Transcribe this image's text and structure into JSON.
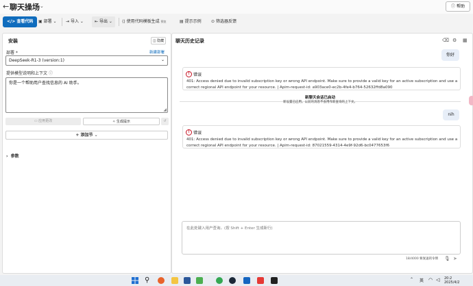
{
  "header": {
    "back_icon": "arrow-left-icon",
    "title": "聊天操场",
    "help_label": "帮助"
  },
  "toolbar": {
    "view_code": "查看代码",
    "deploy": "部署",
    "import": "导入",
    "export": "导出",
    "gen_template": "使用代码模板生成",
    "gen_tag": "预览",
    "prompt_samples": "提示示例",
    "filter_feedback": "筛选器反馈"
  },
  "left": {
    "title": "安装",
    "hide_label": "隐藏",
    "deploy_label": "部署 *",
    "new_deploy_link": "新建部署",
    "deploy_value": "DeepSeek-R1-3 (version:1)",
    "system_label": "提供模型说明和上下文",
    "system_text": "你是一个帮助用户查找信息的 AI 助手。",
    "apply_btn": "应用更改",
    "generate_btn": "生成提示",
    "add_section": "添加节",
    "params": "参数"
  },
  "right": {
    "title": "聊天历史记录",
    "messages": [
      {
        "user": "你好"
      },
      {
        "error_title": "错误",
        "error_text": "401: Access denied due to invalid subscription key or wrong API endpoint. Make sure to provide a valid key for an active subscription and use a correct regional API endpoint for your resource. | Apim-request-id: a903ace0-ec2b-4fe4-b764-52632ffd8a090"
      }
    ],
    "session_title": "新聊天会话已启动",
    "session_sub": "新设置已应用。以前的消息不会用作新查询的上下文。",
    "messages2": [
      {
        "user": "nih"
      },
      {
        "error_title": "错误",
        "error_text": "401: Access denied due to invalid subscription key or wrong API endpoint. Make sure to provide a valid key for an active subscription and use a correct regional API endpoint for your resource. | Apim-request-id: 87021559-4314-4e9f-92d6-bc0477653f6"
      }
    ],
    "input_placeholder": "在此处键入用户查询。(按 Shift + Enter 生成新行)",
    "counter": "18/4000 要发送的令牌"
  },
  "taskbar": {
    "time": "20:2",
    "date": "2025/4/2",
    "lang": "英"
  }
}
